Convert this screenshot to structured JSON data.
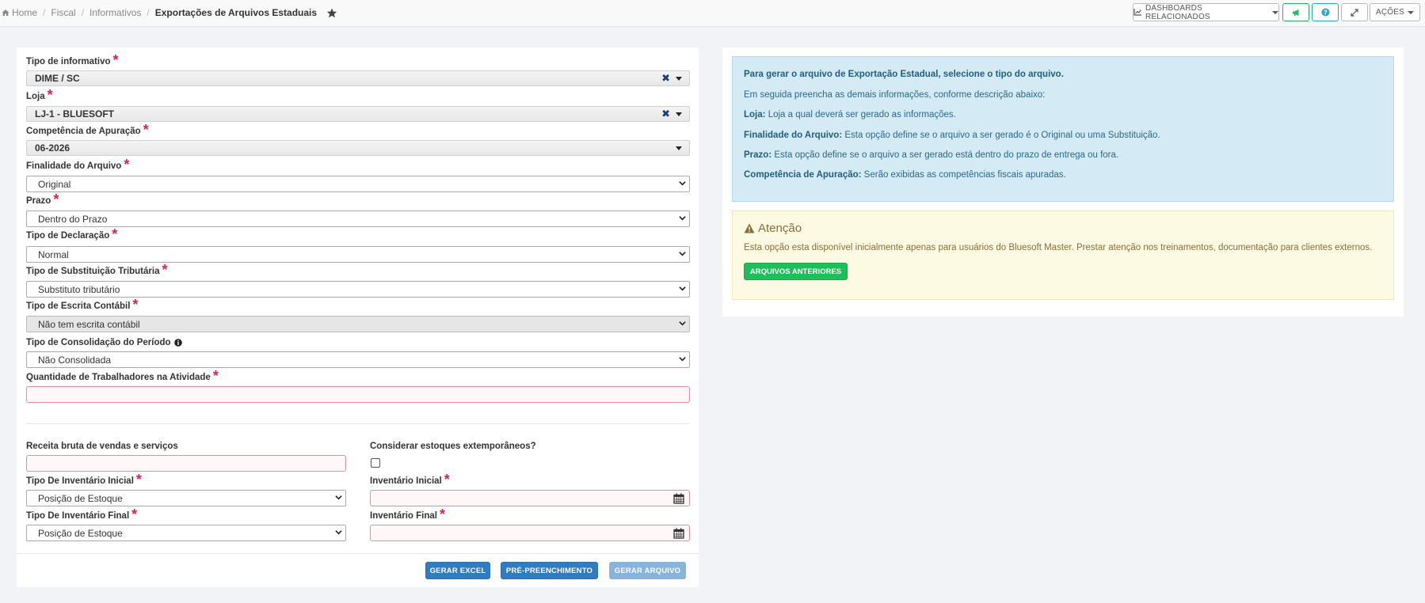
{
  "breadcrumb": {
    "home": "Home",
    "fiscal": "Fiscal",
    "informativos": "Informativos",
    "current": "Exportações de Arquivos Estaduais",
    "separator": "/"
  },
  "toolbar": {
    "dashboards_label": "DASHBOARDS RELACIONADOS",
    "acoes_label": "AÇÕES"
  },
  "form": {
    "tipo_informativo": {
      "label": "Tipo de informativo",
      "value": "DIME / SC"
    },
    "loja": {
      "label": "Loja",
      "value": "LJ-1 - BLUESOFT"
    },
    "competencia": {
      "label": "Competência de Apuração",
      "value": "06-2026"
    },
    "finalidade": {
      "label": "Finalidade do Arquivo",
      "value": "Original"
    },
    "prazo": {
      "label": "Prazo",
      "value": "Dentro do Prazo"
    },
    "tipo_declaracao": {
      "label": "Tipo de Declaração",
      "value": "Normal"
    },
    "tipo_substituicao": {
      "label": "Tipo de Substituição Tributária",
      "value": "Substituto tributário"
    },
    "tipo_escrita": {
      "label": "Tipo de Escrita Contábil",
      "value": "Não tem escrita contábil"
    },
    "tipo_consolidacao": {
      "label": "Tipo de Consolidação do Período",
      "value": "Não Consolidada"
    },
    "qtd_trabalhadores": {
      "label": "Quantidade de Trabalhadores na Atividade",
      "value": ""
    },
    "receita_bruta": {
      "label": "Receita bruta de vendas e serviços",
      "value": ""
    },
    "considerar_estoques": {
      "label": "Considerar estoques extemporâneos?",
      "checked": false
    },
    "tipo_inventario_inicial": {
      "label": "Tipo De Inventário Inicial",
      "value": "Posição de Estoque"
    },
    "inventario_inicial": {
      "label": "Inventário Inicial",
      "value": ""
    },
    "tipo_inventario_final": {
      "label": "Tipo De Inventário Final",
      "value": "Posição de Estoque"
    },
    "inventario_final": {
      "label": "Inventário Final",
      "value": ""
    },
    "required_mark": "*",
    "clear_mark": "✖"
  },
  "actions": {
    "gerar_excel": "GERAR EXCEL",
    "pre_preenchimento": "PRÉ-PREENCHIMENTO",
    "gerar_arquivo": "GERAR ARQUIVO"
  },
  "info": {
    "title": "Para gerar o arquivo de Exportação Estadual, selecione o tipo do arquivo.",
    "intro": "Em seguida preencha as demais informações, conforme descrição abaixo:",
    "loja_term": "Loja:",
    "loja_desc": "Loja a qual deverá ser gerado as informações.",
    "finalidade_term": "Finalidade do Arquivo:",
    "finalidade_desc": "Esta opção define se o arquivo a ser gerado é o Original ou uma Substituição.",
    "prazo_term": "Prazo:",
    "prazo_desc": "Esta opção define se o arquivo a ser gerado está dentro do prazo de entrega ou fora.",
    "competencia_term": "Competência de Apuração:",
    "competencia_desc": "Serão exibidas as competências fiscais apuradas."
  },
  "warning": {
    "title": "Atenção",
    "text": "Esta opção esta disponível inicialmente apenas para usuários do Bluesoft Master. Prestar atenção nos treinamentos, documentação para clientes externos.",
    "button": "ARQUIVOS ANTERIORES"
  }
}
